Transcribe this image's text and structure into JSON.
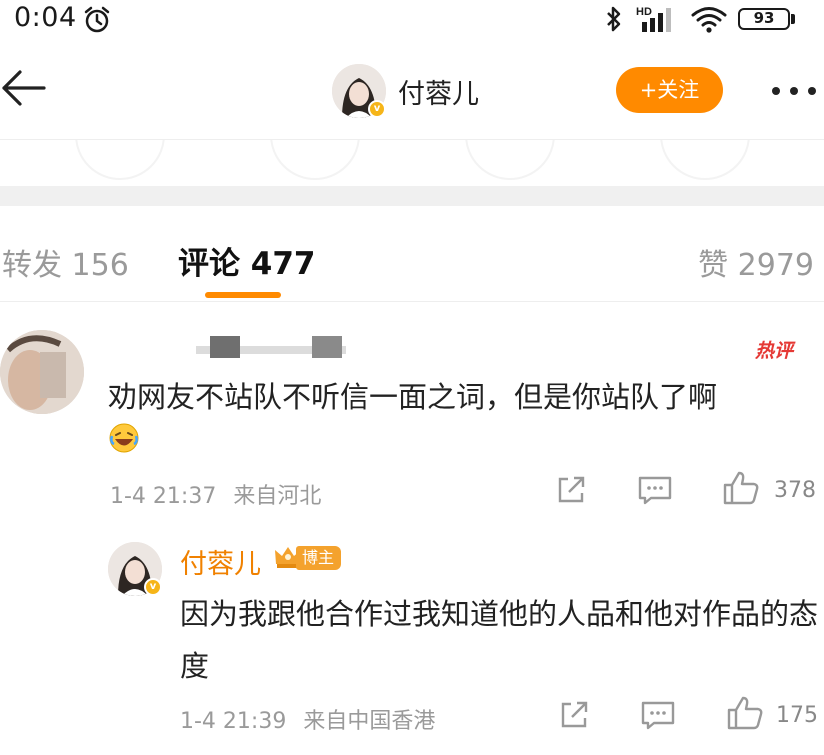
{
  "status_bar": {
    "time": "0:04",
    "network": "HD",
    "battery": "93"
  },
  "navbar": {
    "account_name": "付蓉儿",
    "follow_label": "+关注",
    "verified_mark": "v"
  },
  "tabs": {
    "reposts_label": "转发",
    "reposts_count": "156",
    "comments_label": "评论",
    "comments_count": "477",
    "likes_label": "赞",
    "likes_count": "2979"
  },
  "comment": {
    "hot_tag": "热评",
    "text": "劝网友不站队不听信一面之词，但是你站队了啊",
    "date": "1-4 21:37",
    "location": "来自河北",
    "like_count": "378"
  },
  "reply": {
    "author": "付蓉儿",
    "author_badge": "博主",
    "text": "因为我跟他合作过我知道他的人品和他对作品的态度",
    "date": "1-4 21:39",
    "location": "来自中国香港",
    "like_count": "175"
  },
  "colors": {
    "accent": "#ff8a00",
    "author_name": "#f08100",
    "hot": "#e53935"
  },
  "icons": [
    "alarm-icon",
    "bluetooth-icon",
    "signal-icon",
    "wifi-icon",
    "battery-icon",
    "back-arrow-icon",
    "more-icon",
    "laughing-emoji-icon",
    "share-icon",
    "comment-icon",
    "like-icon",
    "crown-icon"
  ]
}
